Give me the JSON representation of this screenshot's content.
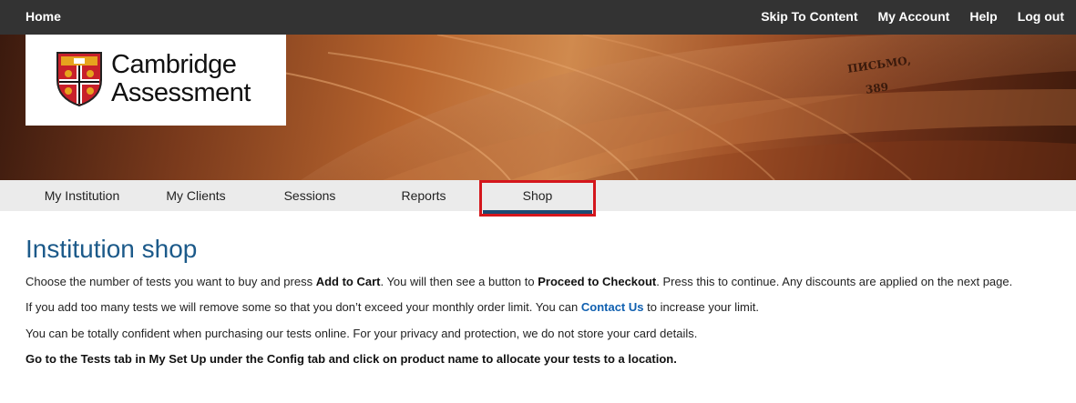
{
  "topbar": {
    "home": "Home",
    "links": [
      "Skip To Content",
      "My Account",
      "Help",
      "Log out"
    ]
  },
  "banner": {
    "logo": {
      "line1": "Cambridge",
      "line2": "Assessment"
    },
    "book_text": [
      "ПИСЬМО,",
      "389"
    ]
  },
  "nav": {
    "items": [
      "My Institution",
      "My Clients",
      "Sessions",
      "Reports",
      "Shop"
    ],
    "active": "Shop"
  },
  "main": {
    "title": "Institution shop",
    "p1": {
      "a": "Choose the number of tests you want to buy and press ",
      "b": "Add to Cart",
      "c": ". You will then see a button to ",
      "d": "Proceed to Checkout",
      "e": ". Press this to continue. Any discounts are applied on the next page."
    },
    "p2": {
      "a": "If you add too many tests we will remove some so that you don’t exceed your monthly order limit. You can ",
      "link": "Contact Us",
      "b": " to increase your limit."
    },
    "p3": "You can be totally confident when purchasing our tests online. For your privacy and protection, we do not store your card details.",
    "p4": "Go to the Tests tab in My Set Up under the Config tab and click on product name to allocate your tests to a location."
  },
  "colors": {
    "topbar_bg": "#333333",
    "nav_bg": "#ebebeb",
    "title": "#1c5a8a",
    "link": "#1060b0",
    "highlight": "#d4161c",
    "active_underline": "#1c4a72"
  }
}
